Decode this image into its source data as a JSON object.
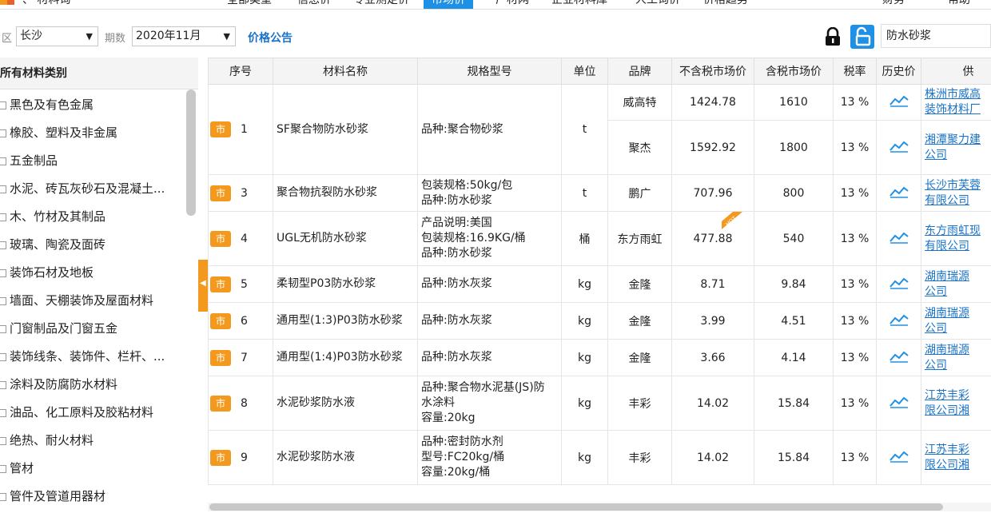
{
  "topnav": {
    "items": [
      "、 材料询",
      "全部类型",
      "信息价",
      "专业测定价",
      "市场价",
      "厂材网",
      "企业材料库",
      "人工询价",
      "价格趋势",
      "财务",
      "帮助"
    ],
    "active": "市场价"
  },
  "toolbar": {
    "area_label": "区",
    "area_value": "长沙",
    "period_label": "期数",
    "period_value": "2020年11月",
    "notice_link": "价格公告",
    "keyword": "防水砂浆"
  },
  "sidebar": {
    "title": "所有材料类别",
    "categories": [
      "黑色及有色金属",
      "橡胶、塑料及非金属",
      "五金制品",
      "水泥、砖瓦灰砂石及混凝土...",
      "木、竹材及其制品",
      "玻璃、陶瓷及面砖",
      "装饰石材及地板",
      "墙面、天棚装饰及屋面材料",
      "门窗制品及门窗五金",
      "装饰线条、装饰件、栏杆、...",
      "涂料及防腐防水材料",
      "油品、化工原料及胶粘材料",
      "绝热、耐火材料",
      "管材",
      "管件及管道用器材"
    ]
  },
  "table": {
    "headers": [
      "序号",
      "材料名称",
      "规格型号",
      "单位",
      "品牌",
      "不含税市场价",
      "含税市场价",
      "税率",
      "历史价",
      "供"
    ],
    "badge": "市",
    "rows": [
      {
        "no": "1",
        "name": "SF聚合物防水砂浆",
        "spec": [
          "品种:聚合物砂浆"
        ],
        "unit": "t",
        "brand": "威高特",
        "price_ex": "1424.78",
        "price_in": "1610",
        "tax": "13 %",
        "supplier": [
          "株洲市威高",
          "装饰材料厂"
        ]
      },
      {
        "no": "",
        "name": "",
        "spec": [],
        "unit": "",
        "brand": "聚杰",
        "price_ex": "1592.92",
        "price_in": "1800",
        "tax": "13 %",
        "supplier": [
          "湘潭聚力建",
          "公司"
        ]
      },
      {
        "no": "3",
        "name": "聚合物抗裂防水砂浆",
        "spec": [
          "包装规格:50kg/包",
          "品种:防水砂浆"
        ],
        "unit": "t",
        "brand": "鹏广",
        "price_ex": "707.96",
        "price_in": "800",
        "tax": "13 %",
        "supplier": [
          "长沙市芙蓉",
          "有限公司"
        ]
      },
      {
        "no": "4",
        "name": "UGL无机防水砂浆",
        "spec": [
          "产品说明:美国",
          "包装规格:16.9KG/桶",
          "品种:防水砂浆"
        ],
        "unit": "桶",
        "brand": "东方雨虹",
        "price_ex": "477.88",
        "price_in": "540",
        "tax": "13 %",
        "supplier": [
          "东方雨虹现",
          "有限公司"
        ]
      },
      {
        "no": "5",
        "name": "柔韧型P03防水砂浆",
        "spec": [
          "品种:防水灰浆"
        ],
        "unit": "kg",
        "brand": "金隆",
        "price_ex": "8.71",
        "price_in": "9.84",
        "tax": "13 %",
        "supplier": [
          "湖南瑞源",
          "公司"
        ]
      },
      {
        "no": "6",
        "name": "通用型(1:3)P03防水砂浆",
        "spec": [
          "品种:防水灰浆"
        ],
        "unit": "kg",
        "brand": "金隆",
        "price_ex": "3.99",
        "price_in": "4.51",
        "tax": "13 %",
        "supplier": [
          "湖南瑞源",
          "公司"
        ]
      },
      {
        "no": "7",
        "name": "通用型(1:4)P03防水砂浆",
        "spec": [
          "品种:防水灰浆"
        ],
        "unit": "kg",
        "brand": "金隆",
        "price_ex": "3.66",
        "price_in": "4.14",
        "tax": "13 %",
        "supplier": [
          "湖南瑞源",
          "公司"
        ]
      },
      {
        "no": "8",
        "name": "水泥砂浆防水液",
        "spec": [
          "品种:聚合物水泥基(JS)防",
          "水涂料",
          "容量:20kg"
        ],
        "unit": "kg",
        "brand": "丰彩",
        "price_ex": "14.02",
        "price_in": "15.84",
        "tax": "13 %",
        "supplier": [
          "江苏丰彩",
          "限公司湘"
        ]
      },
      {
        "no": "9",
        "name": "水泥砂浆防水液",
        "spec": [
          "品种:密封防水剂",
          "型号:FC20kg/桶",
          "容量:20kg/桶"
        ],
        "unit": "kg",
        "brand": "丰彩",
        "price_ex": "14.02",
        "price_in": "15.84",
        "tax": "13 %",
        "supplier": [
          "江苏丰彩",
          "限公司湘"
        ]
      }
    ]
  },
  "hot_label": "HOT",
  "colors": {
    "accent": "#1e90e6",
    "badge": "#f39a1e",
    "link": "#1a73c8"
  }
}
